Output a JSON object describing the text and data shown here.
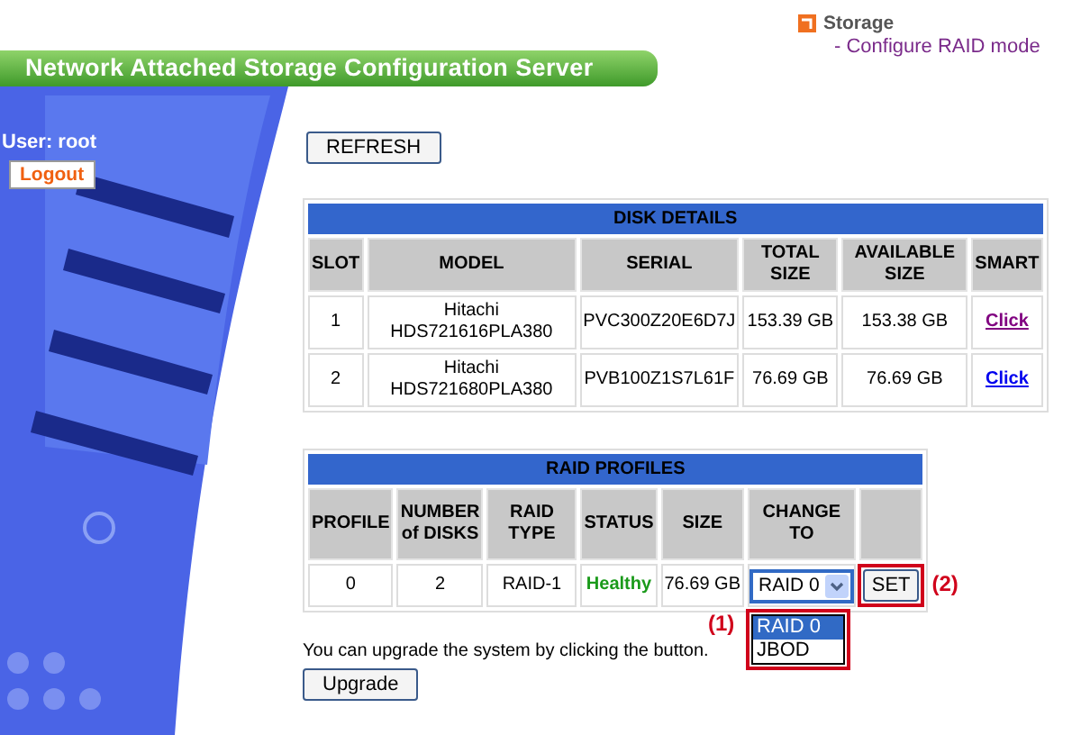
{
  "header": {
    "banner_title": "Network Attached Storage Configuration Server",
    "menu": {
      "section": "Storage",
      "link": "- Configure RAID mode"
    }
  },
  "sidebar": {
    "user_label": "User: root",
    "logout_button": "Logout"
  },
  "refresh_button": "REFRESH",
  "disk_details": {
    "title": "DISK DETAILS",
    "columns": [
      "SLOT",
      "MODEL",
      "SERIAL",
      "TOTAL SIZE",
      "AVAILABLE SIZE",
      "SMART"
    ],
    "rows": [
      {
        "slot": "1",
        "model": "Hitachi HDS721616PLA380",
        "serial": "PVC300Z20E6D7J",
        "total_size": "153.39 GB",
        "available_size": "153.38 GB",
        "smart": "Click",
        "visited": true
      },
      {
        "slot": "2",
        "model": "Hitachi HDS721680PLA380",
        "serial": "PVB100Z1S7L61F",
        "total_size": "76.69 GB",
        "available_size": "76.69 GB",
        "smart": "Click",
        "visited": false
      }
    ]
  },
  "raid_profiles": {
    "title": "RAID PROFILES",
    "columns": [
      "PROFILE",
      "NUMBER of DISKS",
      "RAID TYPE",
      "STATUS",
      "SIZE",
      "CHANGE TO"
    ],
    "rows": [
      {
        "profile": "0",
        "disks": "2",
        "raid_type": "RAID-1",
        "status": {
          "text": "Healthy",
          "kind": "healthy"
        },
        "size": "76.69 GB",
        "change_to": {
          "value": "RAID 0",
          "expanded": true,
          "options": [
            {
              "label": "RAID 0",
              "selected": true
            },
            {
              "label": "JBOD",
              "selected": false
            }
          ]
        },
        "set_button": "SET"
      }
    ]
  },
  "annotations": [
    {
      "label": "(1)",
      "kind": "dropdown"
    },
    {
      "label": "(2)",
      "kind": "button"
    }
  ],
  "upgrade_text": "You can upgrade the system by clicking the button.",
  "upgrade_button": "Upgrade"
}
